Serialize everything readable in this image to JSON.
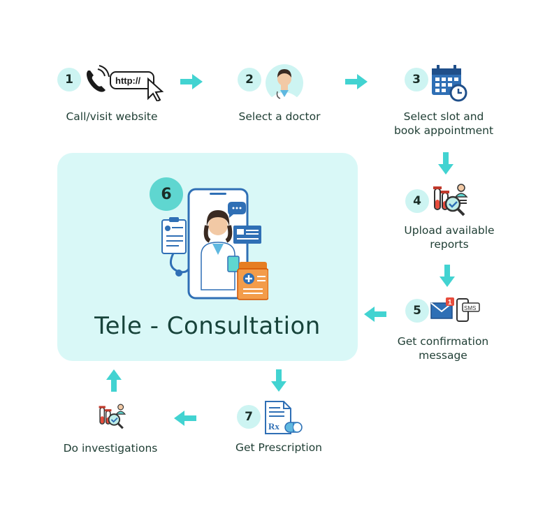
{
  "steps": {
    "s1": {
      "num": "1",
      "label": "Call/visit website",
      "url_text": "http://"
    },
    "s2": {
      "num": "2",
      "label": "Select a doctor"
    },
    "s3": {
      "num": "3",
      "label_line1": "Select slot and",
      "label_line2": "book appointment"
    },
    "s4": {
      "num": "4",
      "label_line1": "Upload available",
      "label_line2": "reports"
    },
    "s5": {
      "num": "5",
      "label_line1": "Get confirmation",
      "label_line2": "message",
      "sms_text": "SMS",
      "badge_text": "1"
    },
    "s6": {
      "num": "6",
      "title": "Tele - Consultation"
    },
    "s7": {
      "num": "7",
      "label": "Get Prescription",
      "rx_text": "Rx"
    },
    "s8": {
      "label": "Do investigations"
    }
  },
  "colors": {
    "accent": "#5fd6d0",
    "circle": "#cdf4f2",
    "panel": "#d9f8f7",
    "icon_blue": "#2f6fb5",
    "arrow": "#42d3d1"
  }
}
